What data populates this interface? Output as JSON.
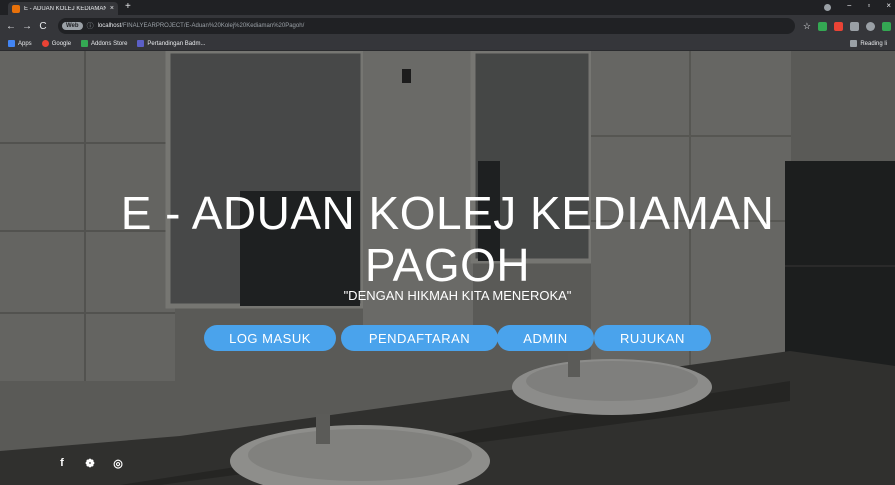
{
  "browser": {
    "tab_title": "E - ADUAN KOLEJ KEDIAMAN PA",
    "tab_close": "×",
    "new_tab": "+",
    "nav": {
      "back": "←",
      "forward": "→",
      "reload": "C"
    },
    "omnibox": {
      "chip": "Web",
      "host": "localhost",
      "path": "/FINALYEARPROJECT/E-Aduan%20Kolej%20Kediaman%20Pagoh/"
    },
    "star": "☆",
    "window_controls": {
      "minimize": "−",
      "maximize": "▫",
      "close": "×"
    },
    "bookmarks": [
      {
        "label": "Apps",
        "color": "#4285f4"
      },
      {
        "label": "Google",
        "color": "#ea4335"
      },
      {
        "label": "Addons Store",
        "color": "#34a853"
      },
      {
        "label": "Pertandingan Badm...",
        "color": "#5b5fc7"
      }
    ],
    "reading_list": "Reading li",
    "extension_colors": [
      "#34a853",
      "#ea4335",
      "#9aa0a6",
      "#9aa0a6",
      "#34a853"
    ]
  },
  "hero": {
    "title_line1": "E - ADUAN KOLEJ KEDIAMAN",
    "title_line2": "PAGOH",
    "tagline": "\"DENGAN HIKMAH KITA MENEROKA\""
  },
  "nav_buttons": {
    "login": "LOG MASUK",
    "register": "PENDAFTARAN",
    "admin": "ADMIN",
    "reference": "RUJUKAN"
  },
  "social": {
    "facebook": "f",
    "twitter": "❁",
    "instagram": "◎"
  },
  "colors": {
    "button": "#4aa3ec",
    "text": "#ffffff"
  }
}
